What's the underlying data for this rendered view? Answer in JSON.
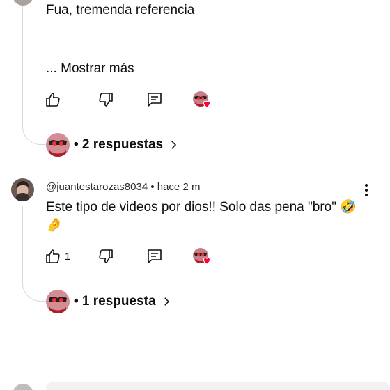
{
  "comment1": {
    "text": "Fua, tremenda referencia",
    "more_label": "... Mostrar más"
  },
  "comment1_replies": {
    "label": "• 2 respuestas"
  },
  "comment2": {
    "author": "@juantestarozas8034",
    "time": "• hace 2 m",
    "text": "Este tipo de videos por dios!! Solo das pena \"bro\" 🤣",
    "text_line2": "🤌",
    "like_count": "1"
  },
  "comment2_replies": {
    "label": "• 1 respuesta"
  },
  "icons": {
    "like": "thumb-up-icon",
    "dislike": "thumb-down-icon",
    "reply": "comment-icon",
    "creator_heart": "creator-heart-icon",
    "more": "more-vert-icon",
    "chevron": "chevron-right-icon"
  },
  "colors": {
    "heart": "#ff0033",
    "thread_line": "#d9d9d9"
  }
}
